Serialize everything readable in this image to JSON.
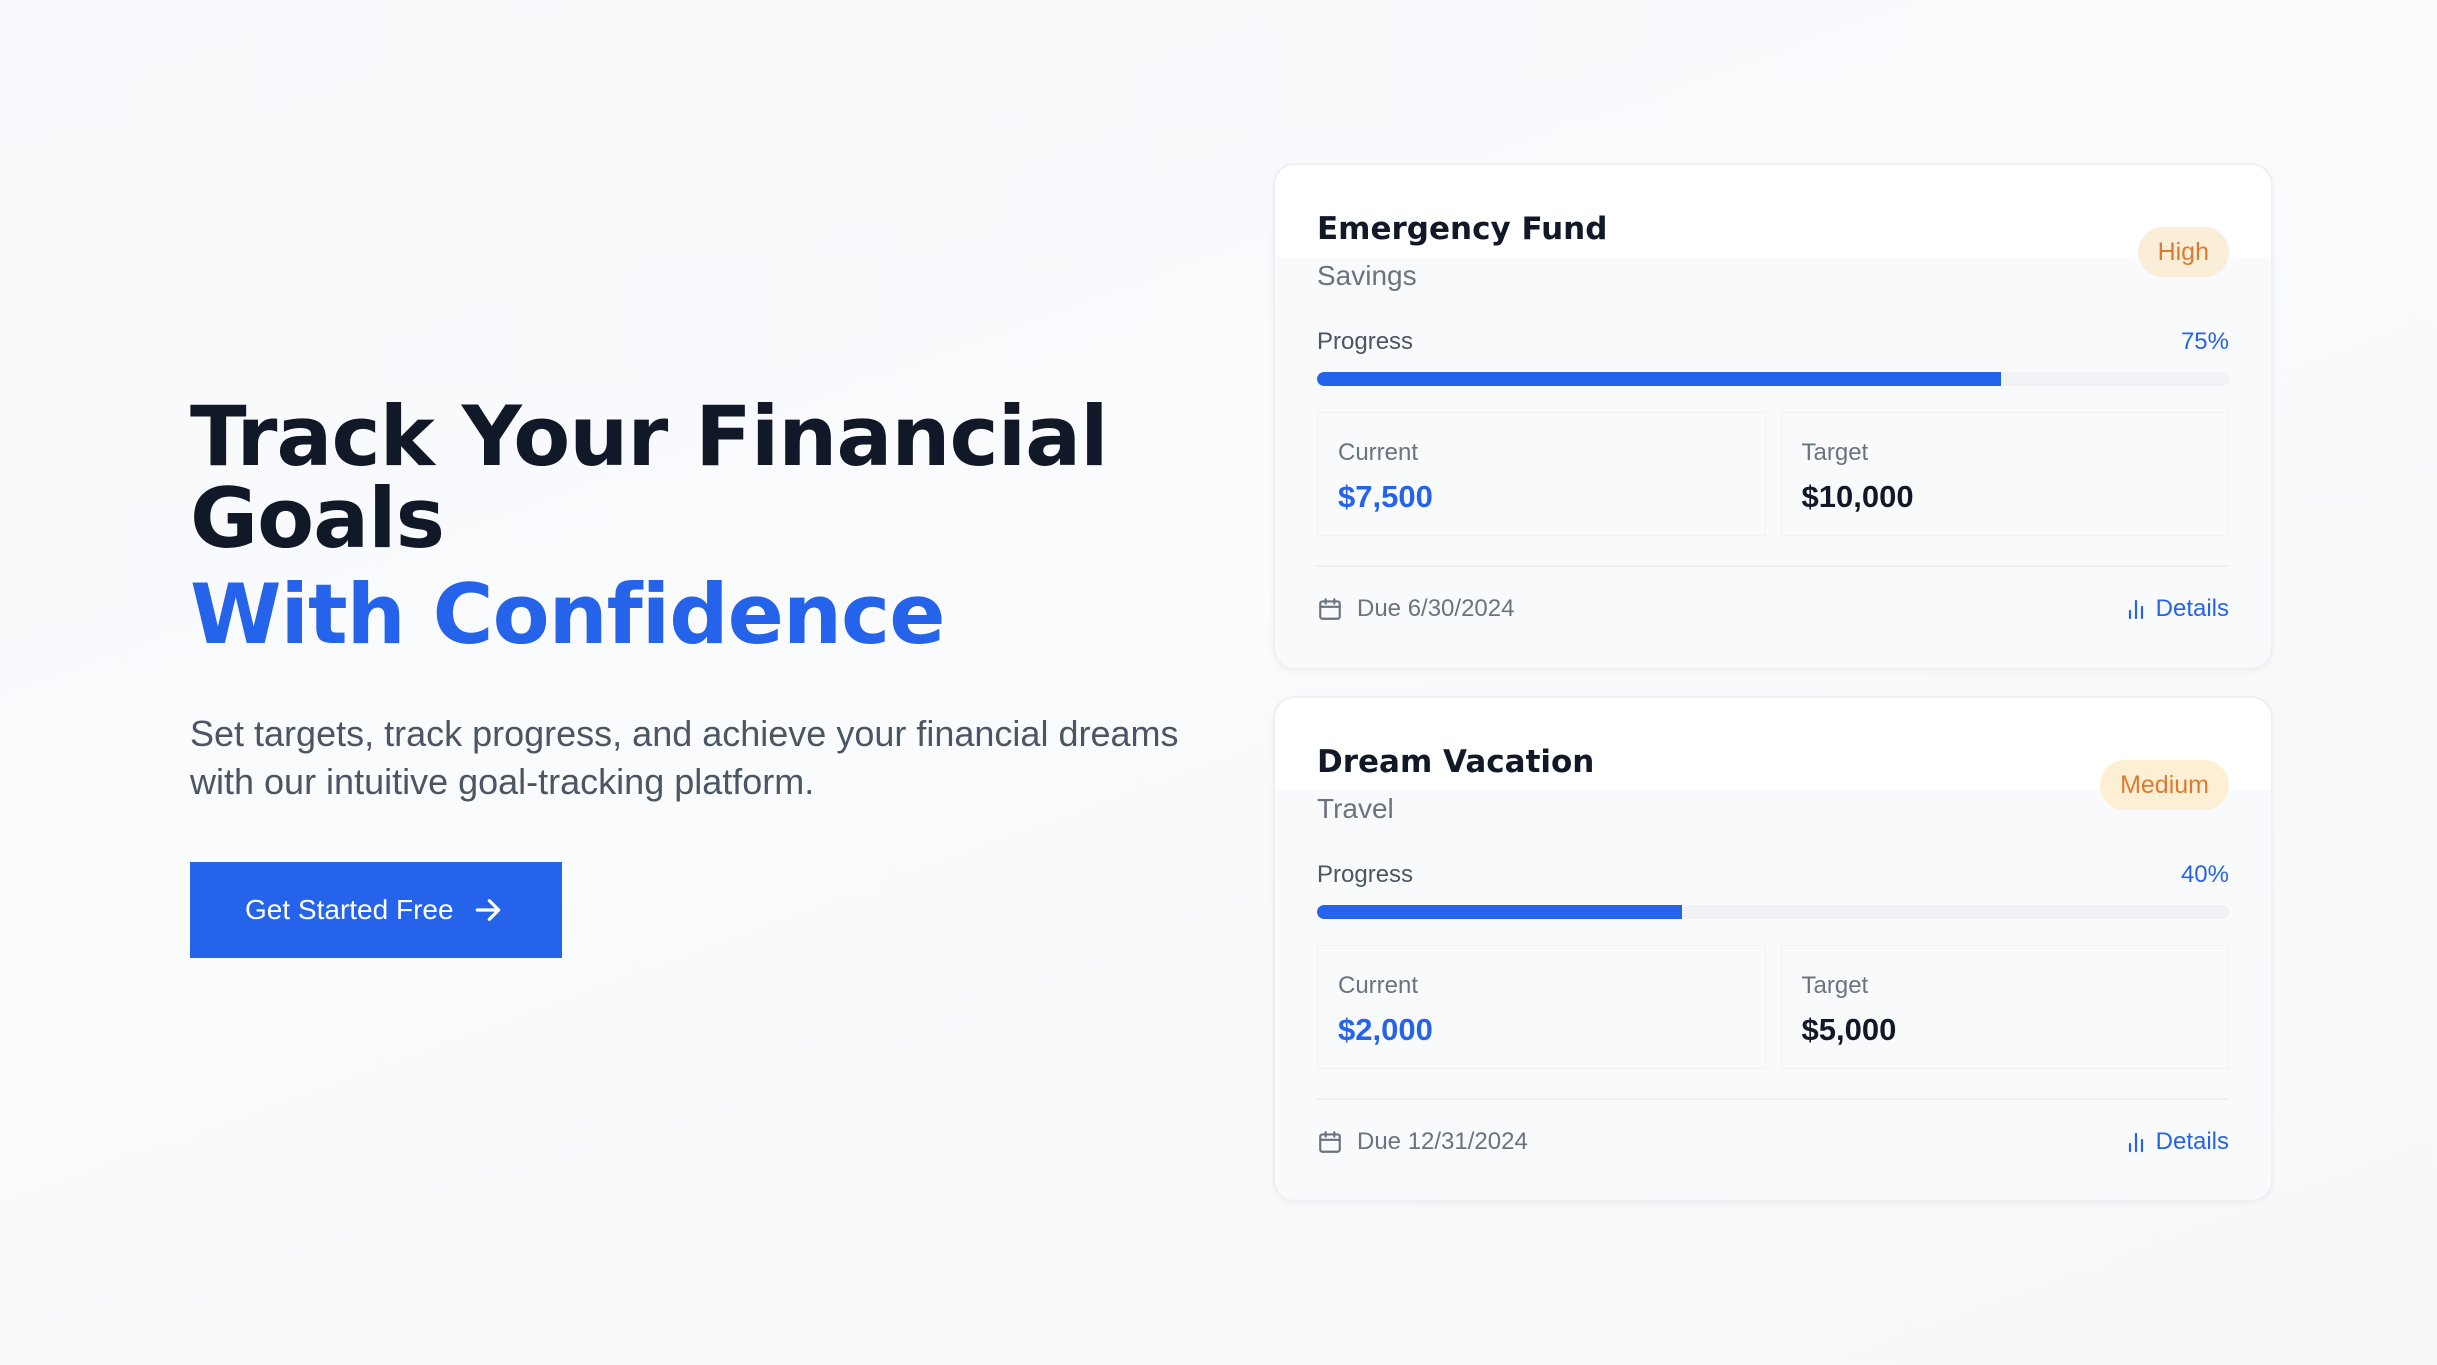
{
  "hero": {
    "headline_line1": "Track Your Financial Goals",
    "headline_accent": "With Confidence",
    "subtitle": "Set targets, track progress, and achieve your financial dreams with our intuitive goal-tracking platform.",
    "cta_label": "Get Started Free",
    "cta_icon": "arrow-right-icon"
  },
  "colors": {
    "accent": "#2563eb",
    "heading": "#111827",
    "badge_text": "#dd7a31",
    "badge_bg": "#fbeed8"
  },
  "goals": [
    {
      "title": "Emergency Fund",
      "category": "Savings",
      "priority": "High",
      "progress_label": "Progress",
      "progress_text": "75%",
      "progress": 0.75,
      "current_label": "Current",
      "current_value": "$7,500",
      "target_label": "Target",
      "target_value": "$10,000",
      "due": "Due 6/30/2024",
      "details_label": "Details"
    },
    {
      "title": "Dream Vacation",
      "category": "Travel",
      "priority": "Medium",
      "progress_label": "Progress",
      "progress_text": "40%",
      "progress": 0.4,
      "current_label": "Current",
      "current_value": "$2,000",
      "target_label": "Target",
      "target_value": "$5,000",
      "due": "Due 12/31/2024",
      "details_label": "Details"
    }
  ]
}
